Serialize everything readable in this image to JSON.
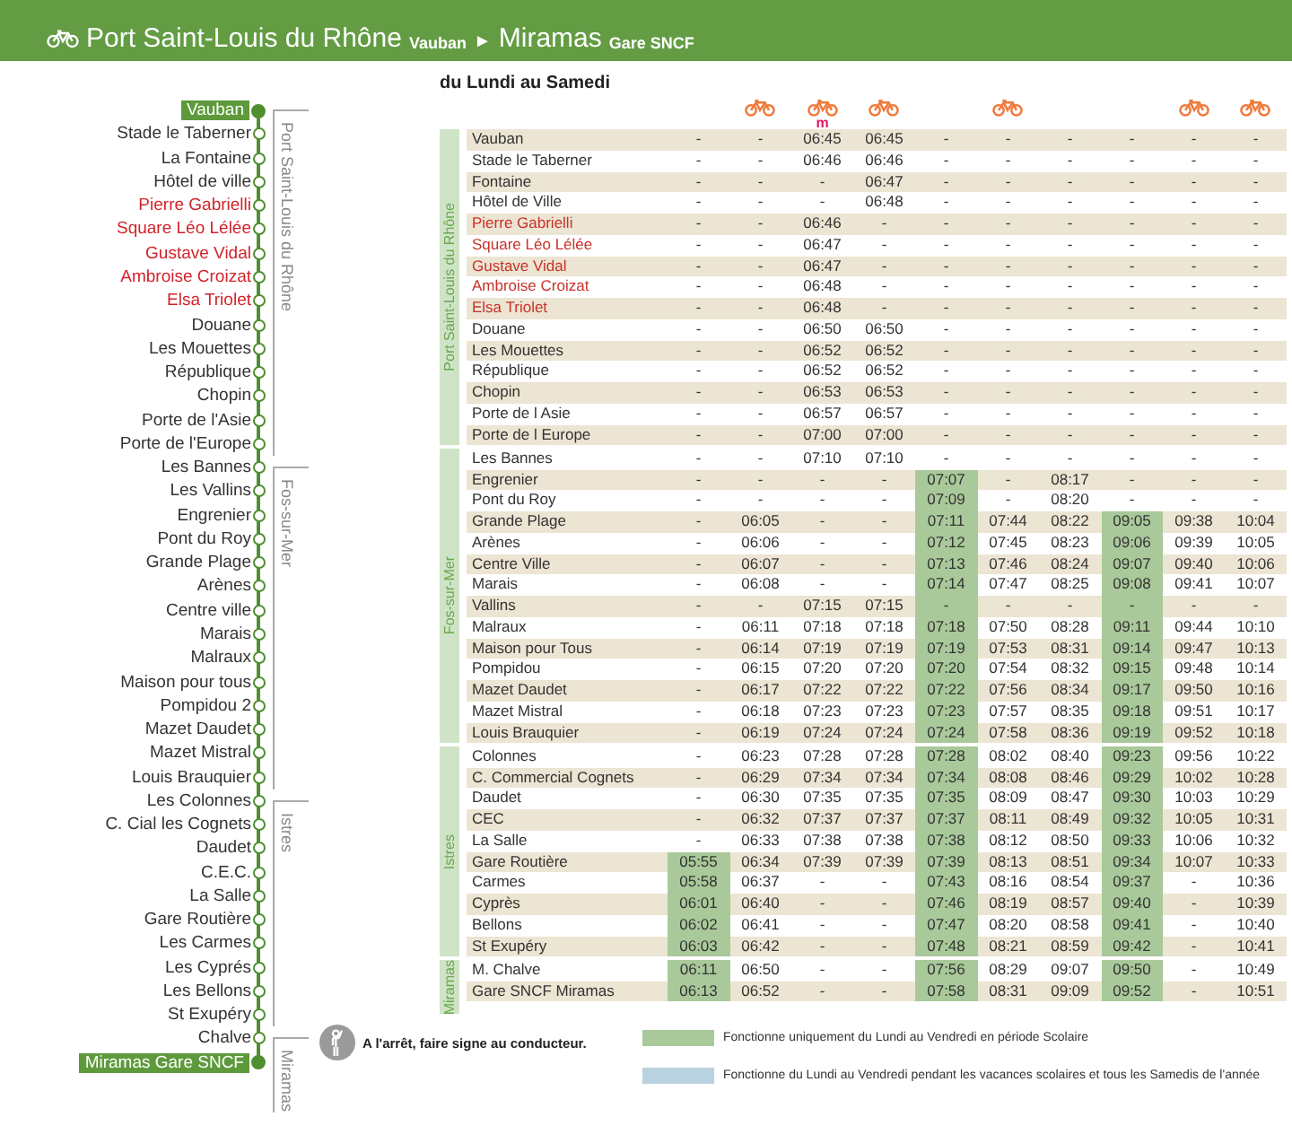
{
  "header": {
    "title": "Port Saint-Louis du Rhône",
    "origin_stop": "Vauban",
    "arrow": "►",
    "destination": "Miramas",
    "destination_stop": "Gare SNCF"
  },
  "line_diagram": {
    "zones": [
      {
        "name": "Port Saint-Louis du Rhône",
        "stops": [
          {
            "name": "Vauban",
            "kind": "terminus"
          },
          {
            "name": "Stade le Taberner",
            "kind": "stop"
          },
          {
            "name": "La Fontaine",
            "kind": "stop"
          },
          {
            "name": "Hôtel de ville",
            "kind": "stop"
          },
          {
            "name": "Pierre Gabrielli",
            "kind": "request"
          },
          {
            "name": "Square Léo Lélée",
            "kind": "request"
          },
          {
            "name": "Gustave Vidal",
            "kind": "request"
          },
          {
            "name": "Ambroise Croizat",
            "kind": "request"
          },
          {
            "name": "Elsa Triolet",
            "kind": "request"
          },
          {
            "name": "Douane",
            "kind": "stop"
          },
          {
            "name": "Les Mouettes",
            "kind": "stop"
          },
          {
            "name": "République",
            "kind": "stop"
          },
          {
            "name": "Chopin",
            "kind": "stop"
          },
          {
            "name": "Porte de l'Asie",
            "kind": "stop"
          },
          {
            "name": "Porte de l'Europe",
            "kind": "stop"
          }
        ]
      },
      {
        "name": "Fos-sur-Mer",
        "stops": [
          {
            "name": "Les Bannes",
            "kind": "stop"
          },
          {
            "name": "Les Vallins",
            "kind": "stop"
          },
          {
            "name": "Engrenier",
            "kind": "stop"
          },
          {
            "name": "Pont du Roy",
            "kind": "stop"
          },
          {
            "name": "Grande Plage",
            "kind": "stop"
          },
          {
            "name": "Arènes",
            "kind": "stop"
          },
          {
            "name": "Centre ville",
            "kind": "stop"
          },
          {
            "name": "Marais",
            "kind": "stop"
          },
          {
            "name": "Malraux",
            "kind": "stop"
          },
          {
            "name": "Maison pour tous",
            "kind": "stop"
          },
          {
            "name": "Pompidou 2",
            "kind": "stop"
          },
          {
            "name": "Mazet Daudet",
            "kind": "stop"
          },
          {
            "name": "Mazet Mistral",
            "kind": "stop"
          },
          {
            "name": "Louis Brauquier",
            "kind": "stop"
          }
        ]
      },
      {
        "name": "Istres",
        "stops": [
          {
            "name": "Les Colonnes",
            "kind": "stop"
          },
          {
            "name": "C. Cial les Cognets",
            "kind": "stop"
          },
          {
            "name": "Daudet",
            "kind": "stop"
          },
          {
            "name": "C.E.C.",
            "kind": "stop"
          },
          {
            "name": "La Salle",
            "kind": "stop"
          },
          {
            "name": "Gare Routière",
            "kind": "stop"
          },
          {
            "name": "Les Carmes",
            "kind": "stop"
          },
          {
            "name": "Les Cyprés",
            "kind": "stop"
          },
          {
            "name": "Les Bellons",
            "kind": "stop"
          },
          {
            "name": "St Exupéry",
            "kind": "stop"
          }
        ]
      },
      {
        "name": "Miramas",
        "stops": [
          {
            "name": "Chalve",
            "kind": "stop"
          },
          {
            "name": "Miramas Gare SNCF",
            "kind": "terminus"
          }
        ]
      }
    ]
  },
  "timetable": {
    "days": "du Lundi au Samedi",
    "columns": [
      {
        "bike": false,
        "school_period": true
      },
      {
        "bike": true,
        "school_period": false
      },
      {
        "bike": true,
        "note": "m",
        "school_period": false
      },
      {
        "bike": true,
        "school_period": false
      },
      {
        "bike": false,
        "school_period": true
      },
      {
        "bike": true,
        "school_period": false
      },
      {
        "bike": false,
        "school_period": false
      },
      {
        "bike": false,
        "school_period": true
      },
      {
        "bike": true,
        "school_period": false
      },
      {
        "bike": true,
        "school_period": false
      }
    ],
    "zones": [
      {
        "name": "Port Saint-Louis du Rhône",
        "rows": [
          {
            "stop": "Vauban",
            "kind": "stop",
            "times": [
              "-",
              "-",
              "06:45",
              "06:45",
              "-",
              "-",
              "-",
              "-",
              "-",
              "-"
            ]
          },
          {
            "stop": "Stade le Taberner",
            "kind": "stop",
            "times": [
              "-",
              "-",
              "06:46",
              "06:46",
              "-",
              "-",
              "-",
              "-",
              "-",
              "-"
            ]
          },
          {
            "stop": "Fontaine",
            "kind": "stop",
            "times": [
              "-",
              "-",
              "-",
              "06:47",
              "-",
              "-",
              "-",
              "-",
              "-",
              "-"
            ]
          },
          {
            "stop": "Hôtel de Ville",
            "kind": "stop",
            "times": [
              "-",
              "-",
              "-",
              "06:48",
              "-",
              "-",
              "-",
              "-",
              "-",
              "-"
            ]
          },
          {
            "stop": "Pierre Gabrielli",
            "kind": "request",
            "times": [
              "-",
              "-",
              "06:46",
              "-",
              "-",
              "-",
              "-",
              "-",
              "-",
              "-"
            ]
          },
          {
            "stop": "Square Léo Lélée",
            "kind": "request",
            "times": [
              "-",
              "-",
              "06:47",
              "-",
              "-",
              "-",
              "-",
              "-",
              "-",
              "-"
            ]
          },
          {
            "stop": "Gustave Vidal",
            "kind": "request",
            "times": [
              "-",
              "-",
              "06:47",
              "-",
              "-",
              "-",
              "-",
              "-",
              "-",
              "-"
            ]
          },
          {
            "stop": "Ambroise Croizat",
            "kind": "request",
            "times": [
              "-",
              "-",
              "06:48",
              "-",
              "-",
              "-",
              "-",
              "-",
              "-",
              "-"
            ]
          },
          {
            "stop": "Elsa Triolet",
            "kind": "request",
            "times": [
              "-",
              "-",
              "06:48",
              "-",
              "-",
              "-",
              "-",
              "-",
              "-",
              "-"
            ]
          },
          {
            "stop": "Douane",
            "kind": "stop",
            "times": [
              "-",
              "-",
              "06:50",
              "06:50",
              "-",
              "-",
              "-",
              "-",
              "-",
              "-"
            ]
          },
          {
            "stop": "Les Mouettes",
            "kind": "stop",
            "times": [
              "-",
              "-",
              "06:52",
              "06:52",
              "-",
              "-",
              "-",
              "-",
              "-",
              "-"
            ]
          },
          {
            "stop": "République",
            "kind": "stop",
            "times": [
              "-",
              "-",
              "06:52",
              "06:52",
              "-",
              "-",
              "-",
              "-",
              "-",
              "-"
            ]
          },
          {
            "stop": "Chopin",
            "kind": "stop",
            "times": [
              "-",
              "-",
              "06:53",
              "06:53",
              "-",
              "-",
              "-",
              "-",
              "-",
              "-"
            ]
          },
          {
            "stop": "Porte de l Asie",
            "kind": "stop",
            "times": [
              "-",
              "-",
              "06:57",
              "06:57",
              "-",
              "-",
              "-",
              "-",
              "-",
              "-"
            ]
          },
          {
            "stop": "Porte de l Europe",
            "kind": "stop",
            "times": [
              "-",
              "-",
              "07:00",
              "07:00",
              "-",
              "-",
              "-",
              "-",
              "-",
              "-"
            ]
          }
        ]
      },
      {
        "name": "Fos-sur-Mer",
        "rows": [
          {
            "stop": "Les Bannes",
            "kind": "stop",
            "times": [
              "-",
              "-",
              "07:10",
              "07:10",
              "-",
              "-",
              "-",
              "-",
              "-",
              "-"
            ]
          },
          {
            "stop": "Engrenier",
            "kind": "stop",
            "times": [
              "-",
              "-",
              "-",
              "-",
              "07:07",
              "-",
              "08:17",
              "-",
              "-",
              "-"
            ]
          },
          {
            "stop": "Pont du Roy",
            "kind": "stop",
            "times": [
              "-",
              "-",
              "-",
              "-",
              "07:09",
              "-",
              "08:20",
              "-",
              "-",
              "-"
            ]
          },
          {
            "stop": "Grande Plage",
            "kind": "stop",
            "times": [
              "-",
              "06:05",
              "-",
              "-",
              "07:11",
              "07:44",
              "08:22",
              "09:05",
              "09:38",
              "10:04"
            ]
          },
          {
            "stop": "Arènes",
            "kind": "stop",
            "times": [
              "-",
              "06:06",
              "-",
              "-",
              "07:12",
              "07:45",
              "08:23",
              "09:06",
              "09:39",
              "10:05"
            ]
          },
          {
            "stop": "Centre Ville",
            "kind": "stop",
            "times": [
              "-",
              "06:07",
              "-",
              "-",
              "07:13",
              "07:46",
              "08:24",
              "09:07",
              "09:40",
              "10:06"
            ]
          },
          {
            "stop": "Marais",
            "kind": "stop",
            "times": [
              "-",
              "06:08",
              "-",
              "-",
              "07:14",
              "07:47",
              "08:25",
              "09:08",
              "09:41",
              "10:07"
            ]
          },
          {
            "stop": "Vallins",
            "kind": "stop",
            "times": [
              "-",
              "-",
              "07:15",
              "07:15",
              "-",
              "-",
              "-",
              "-",
              "-",
              "-"
            ]
          },
          {
            "stop": "Malraux",
            "kind": "stop",
            "times": [
              "-",
              "06:11",
              "07:18",
              "07:18",
              "07:18",
              "07:50",
              "08:28",
              "09:11",
              "09:44",
              "10:10"
            ]
          },
          {
            "stop": "Maison pour Tous",
            "kind": "stop",
            "times": [
              "-",
              "06:14",
              "07:19",
              "07:19",
              "07:19",
              "07:53",
              "08:31",
              "09:14",
              "09:47",
              "10:13"
            ]
          },
          {
            "stop": "Pompidou",
            "kind": "stop",
            "times": [
              "-",
              "06:15",
              "07:20",
              "07:20",
              "07:20",
              "07:54",
              "08:32",
              "09:15",
              "09:48",
              "10:14"
            ]
          },
          {
            "stop": "Mazet Daudet",
            "kind": "stop",
            "times": [
              "-",
              "06:17",
              "07:22",
              "07:22",
              "07:22",
              "07:56",
              "08:34",
              "09:17",
              "09:50",
              "10:16"
            ]
          },
          {
            "stop": "Mazet Mistral",
            "kind": "stop",
            "times": [
              "-",
              "06:18",
              "07:23",
              "07:23",
              "07:23",
              "07:57",
              "08:35",
              "09:18",
              "09:51",
              "10:17"
            ]
          },
          {
            "stop": "Louis Brauquier",
            "kind": "stop",
            "times": [
              "-",
              "06:19",
              "07:24",
              "07:24",
              "07:24",
              "07:58",
              "08:36",
              "09:19",
              "09:52",
              "10:18"
            ]
          }
        ]
      },
      {
        "name": "Istres",
        "rows": [
          {
            "stop": "Colonnes",
            "kind": "stop",
            "times": [
              "-",
              "06:23",
              "07:28",
              "07:28",
              "07:28",
              "08:02",
              "08:40",
              "09:23",
              "09:56",
              "10:22"
            ]
          },
          {
            "stop": "C. Commercial Cognets",
            "kind": "stop",
            "times": [
              "-",
              "06:29",
              "07:34",
              "07:34",
              "07:34",
              "08:08",
              "08:46",
              "09:29",
              "10:02",
              "10:28"
            ]
          },
          {
            "stop": "Daudet",
            "kind": "stop",
            "times": [
              "-",
              "06:30",
              "07:35",
              "07:35",
              "07:35",
              "08:09",
              "08:47",
              "09:30",
              "10:03",
              "10:29"
            ]
          },
          {
            "stop": "CEC",
            "kind": "stop",
            "times": [
              "-",
              "06:32",
              "07:37",
              "07:37",
              "07:37",
              "08:11",
              "08:49",
              "09:32",
              "10:05",
              "10:31"
            ]
          },
          {
            "stop": "La Salle",
            "kind": "stop",
            "times": [
              "-",
              "06:33",
              "07:38",
              "07:38",
              "07:38",
              "08:12",
              "08:50",
              "09:33",
              "10:06",
              "10:32"
            ]
          },
          {
            "stop": "Gare Routière",
            "kind": "stop",
            "times": [
              "05:55",
              "06:34",
              "07:39",
              "07:39",
              "07:39",
              "08:13",
              "08:51",
              "09:34",
              "10:07",
              "10:33"
            ]
          },
          {
            "stop": "Carmes",
            "kind": "stop",
            "times": [
              "05:58",
              "06:37",
              "-",
              "-",
              "07:43",
              "08:16",
              "08:54",
              "09:37",
              "-",
              "10:36"
            ]
          },
          {
            "stop": "Cyprès",
            "kind": "stop",
            "times": [
              "06:01",
              "06:40",
              "-",
              "-",
              "07:46",
              "08:19",
              "08:57",
              "09:40",
              "-",
              "10:39"
            ]
          },
          {
            "stop": "Bellons",
            "kind": "stop",
            "times": [
              "06:02",
              "06:41",
              "-",
              "-",
              "07:47",
              "08:20",
              "08:58",
              "09:41",
              "-",
              "10:40"
            ]
          },
          {
            "stop": "St Exupéry",
            "kind": "stop",
            "times": [
              "06:03",
              "06:42",
              "-",
              "-",
              "07:48",
              "08:21",
              "08:59",
              "09:42",
              "-",
              "10:41"
            ]
          }
        ]
      },
      {
        "name": "Miramas",
        "rows": [
          {
            "stop": "M. Chalve",
            "kind": "stop",
            "times": [
              "06:11",
              "06:50",
              "-",
              "-",
              "07:56",
              "08:29",
              "09:07",
              "09:50",
              "-",
              "10:49"
            ]
          },
          {
            "stop": "Gare SNCF Miramas",
            "kind": "stop",
            "times": [
              "06:13",
              "06:52",
              "-",
              "-",
              "07:58",
              "08:31",
              "09:09",
              "09:52",
              "-",
              "10:51"
            ]
          }
        ]
      }
    ]
  },
  "footer": {
    "note": "A l'arrêt, faire signe au conducteur.",
    "legend": [
      {
        "color": "#a9c99a",
        "text": "Fonctionne uniquement du Lundi au Vendredi en période Scolaire"
      },
      {
        "color": "#b8d3df",
        "text": "Fonctionne du Lundi au Vendredi pendant les vacances scolaires et tous les Samedis de l'année"
      }
    ]
  }
}
